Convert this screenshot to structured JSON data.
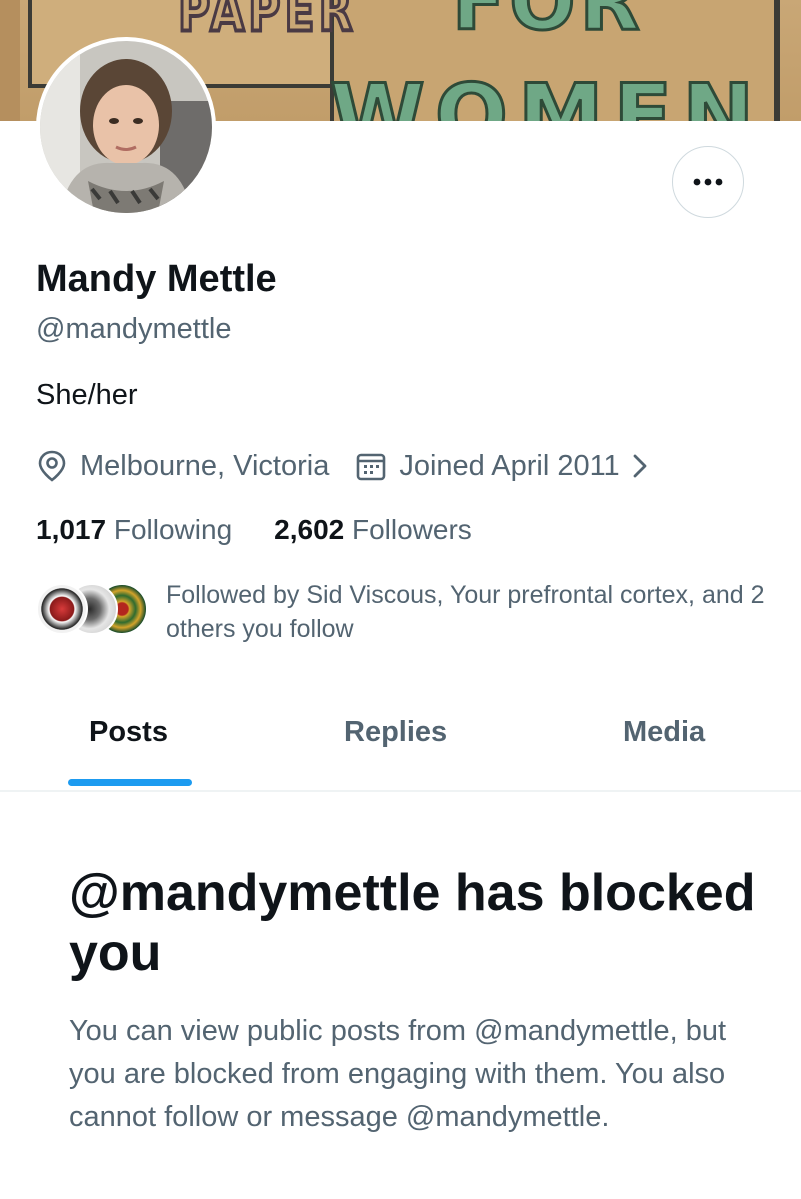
{
  "banner": {
    "words": [
      "PAPER",
      "FOR",
      "WOMEN"
    ]
  },
  "profile": {
    "name": "Mandy Mettle",
    "handle": "@mandymettle",
    "bio": "She/her",
    "location": "Melbourne, Victoria",
    "joined": "Joined April 2011",
    "following_count": "1,017",
    "following_label": "Following",
    "followers_count": "2,602",
    "followers_label": "Followers",
    "followed_by_text": "Followed by Sid Viscous, Your prefrontal cortex, and 2 others you follow"
  },
  "icons": {
    "more": "more-dots-icon",
    "location": "location-pin-icon",
    "joined": "calendar-icon",
    "joined_chevron": "chevron-right-icon"
  },
  "tabs": [
    {
      "label": "Posts",
      "active": true
    },
    {
      "label": "Replies",
      "active": false
    },
    {
      "label": "Media",
      "active": false
    }
  ],
  "blocked": {
    "title": "@mandymettle has blocked you",
    "body": "You can view public posts from @mandymettle, but you are blocked from engaging with them. You also cannot follow or message @mandymettle."
  },
  "colors": {
    "accent": "#1d9bf0",
    "text_primary": "#0f1419",
    "text_secondary": "#536471",
    "border": "#cfd9de"
  }
}
